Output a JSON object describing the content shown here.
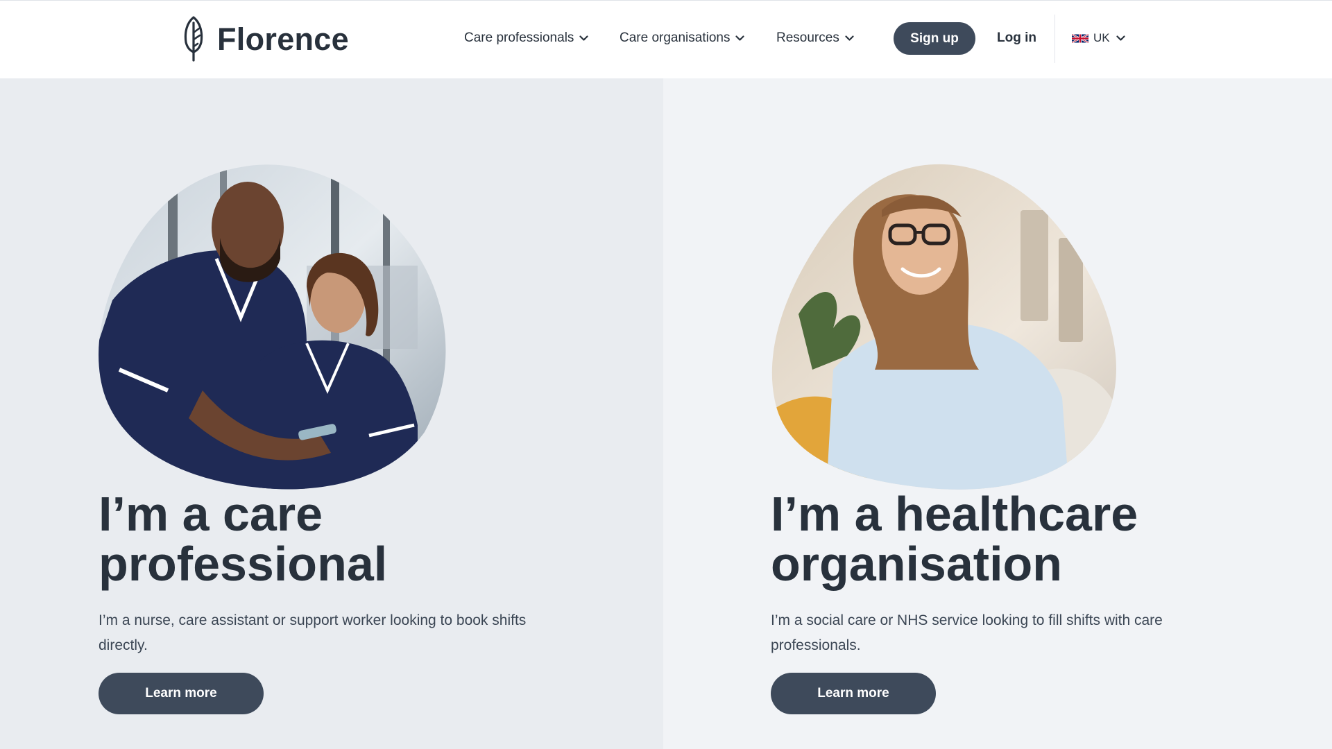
{
  "brand": {
    "name": "Florence",
    "logo_icon": "feather-icon"
  },
  "nav": {
    "items": [
      {
        "label": "Care professionals",
        "icon": "chevron-down-icon"
      },
      {
        "label": "Care organisations",
        "icon": "chevron-down-icon"
      },
      {
        "label": "Resources",
        "icon": "chevron-down-icon"
      }
    ],
    "signup_label": "Sign up",
    "login_label": "Log in",
    "locale": {
      "label": "UK",
      "flag_icon": "uk-flag-icon",
      "icon": "chevron-down-icon"
    }
  },
  "cards": [
    {
      "title": "I’m a care professional",
      "description": "I’m a nurse, care assistant or support worker looking to book shifts directly.",
      "button_label": "Learn more",
      "image": "two-care-workers-looking-at-phone-photo"
    },
    {
      "title": "I’m a healthcare organisation",
      "description": "I’m a social care or NHS service looking to fill shifts with care professionals.",
      "button_label": "Learn more",
      "image": "smiling-woman-with-glasses-photo"
    }
  ],
  "colors": {
    "primary_button": "#3e4a5b",
    "text": "#28313c",
    "panel_left_bg": "#e9ecf0",
    "panel_right_bg": "#f1f3f6"
  }
}
